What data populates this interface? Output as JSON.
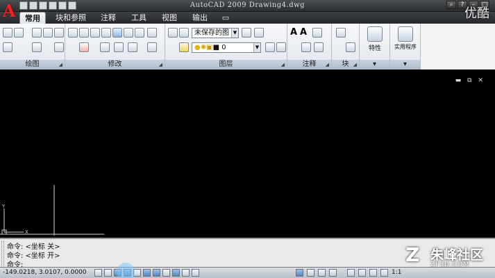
{
  "window": {
    "title": "AutoCAD 2009  Drawing4.dwg"
  },
  "tabs": [
    {
      "label": "常用",
      "active": true
    },
    {
      "label": "块和参照",
      "active": false
    },
    {
      "label": "注释",
      "active": false
    },
    {
      "label": "工具",
      "active": false
    },
    {
      "label": "视图",
      "active": false
    },
    {
      "label": "输出",
      "active": false
    }
  ],
  "panels": {
    "draw": "绘图",
    "modify": "修改",
    "layers": "图层",
    "annotation": "注释",
    "block": "块",
    "properties": "特性",
    "utilities": "实用程序"
  },
  "layers": {
    "state_combo": "未保存的图",
    "layer_combo": "0"
  },
  "command": {
    "lines": [
      "命令:  <坐标 关>",
      "命令:  <坐标 开>",
      "命令:"
    ]
  },
  "status": {
    "coords": "-149.0218,  3.0107,  0.0000",
    "scale": "1:1"
  },
  "watermark": {
    "text": "朱峰社区",
    "sub": "ZF3D.COM",
    "corner": "优酷"
  },
  "colors": {
    "accent": "#4d86c2",
    "ribbon": "#e2e6eb",
    "canvas": "#000000"
  }
}
